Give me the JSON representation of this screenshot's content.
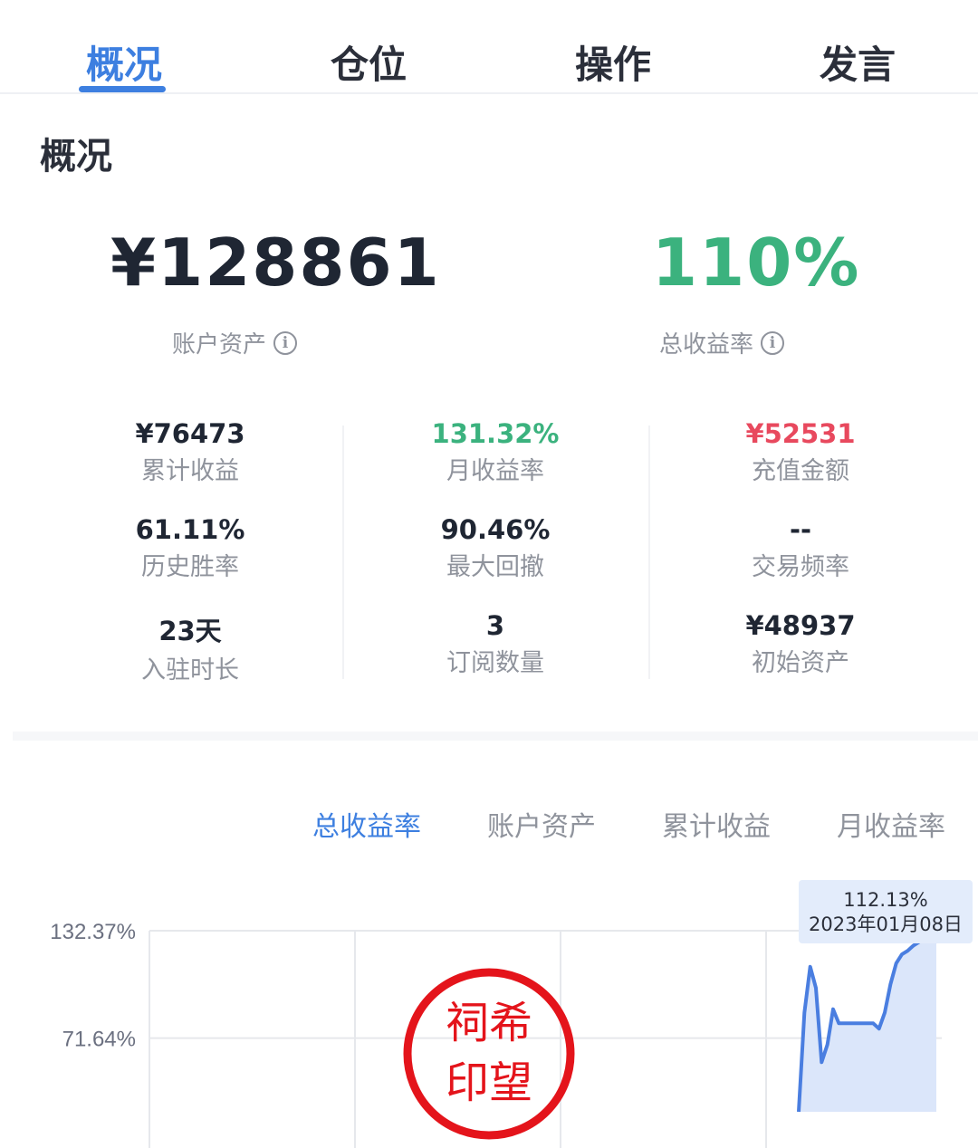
{
  "tabs": [
    {
      "label": "概况"
    },
    {
      "label": "仓位"
    },
    {
      "label": "操作"
    },
    {
      "label": "发言"
    }
  ],
  "section_title": "概况",
  "headline": {
    "assets_value": "¥128861",
    "assets_label": "账户资产",
    "return_value": "110%",
    "return_label": "总收益率"
  },
  "stats": [
    {
      "value": "¥76473",
      "label": "累计收益",
      "color": "#1f2633"
    },
    {
      "value": "131.32%",
      "label": "月收益率",
      "color": "#3bb27e"
    },
    {
      "value": "¥52531",
      "label": "充值金额",
      "color": "#e8495e"
    },
    {
      "value": "61.11%",
      "label": "历史胜率",
      "color": "#1f2633"
    },
    {
      "value": "90.46%",
      "label": "最大回撤",
      "color": "#1f2633"
    },
    {
      "value": "--",
      "label": "交易频率",
      "color": "#1f2633"
    },
    {
      "value": "23天",
      "label": "入驻时长",
      "color": "#1f2633"
    },
    {
      "value": "3",
      "label": "订阅数量",
      "color": "#1f2633"
    },
    {
      "value": "¥48937",
      "label": "初始资产",
      "color": "#1f2633"
    }
  ],
  "chart_tabs": [
    {
      "label": "总收益率"
    },
    {
      "label": "账户资产"
    },
    {
      "label": "累计收益"
    },
    {
      "label": "月收益率"
    }
  ],
  "chart_data": {
    "type": "area",
    "title": "",
    "y_tick_labels": [
      "132.37%",
      "71.64%"
    ],
    "ylim": [
      30,
      132.37
    ],
    "grid": true,
    "color": "#4a7ee0",
    "series": [
      {
        "values": [
          30,
          86,
          112,
          100,
          58,
          68,
          88,
          80,
          80,
          80,
          80,
          80,
          80,
          80,
          77,
          86,
          102,
          114,
          119,
          121,
          124,
          126,
          129,
          130,
          131
        ]
      }
    ],
    "tooltip": {
      "value": "112.13%",
      "date": "2023年01月08日"
    }
  },
  "stamp": {
    "line1": "祠希",
    "line2": "印望",
    "color": "#e4141b"
  },
  "colors": {
    "accent": "#3d7fe0",
    "positive": "#3bb27e",
    "negative": "#e8495e"
  }
}
